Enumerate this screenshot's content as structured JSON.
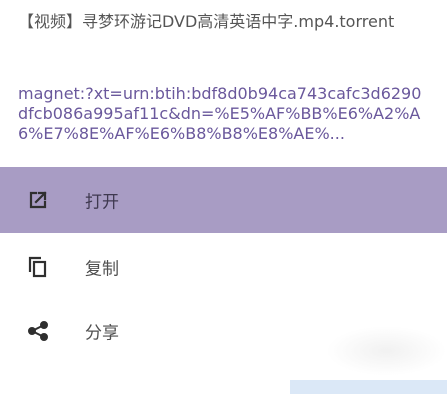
{
  "dialog": {
    "title": "【视频】寻梦环游记DVD高清英语中字.mp4.torrent",
    "magnet_text": "magnet:?xt=urn:btih:bdf8d0b94ca743cafc3d6290dfcb086a995af11c&dn=%E5%AF%BB%E6%A2%A6%E7%8E%AF%E6%B8%B8%E8%AE%..."
  },
  "menu": {
    "items": [
      {
        "label": "打开",
        "icon": "open-external-icon",
        "active": true
      },
      {
        "label": "复制",
        "icon": "copy-icon",
        "active": false
      },
      {
        "label": "分享",
        "icon": "share-icon",
        "active": false
      }
    ]
  },
  "colors": {
    "active_background": "#a89cc4",
    "link_text": "#6a589c",
    "title_text": "#555555",
    "icon": "#333333",
    "label_text": "#4f4f4f"
  }
}
